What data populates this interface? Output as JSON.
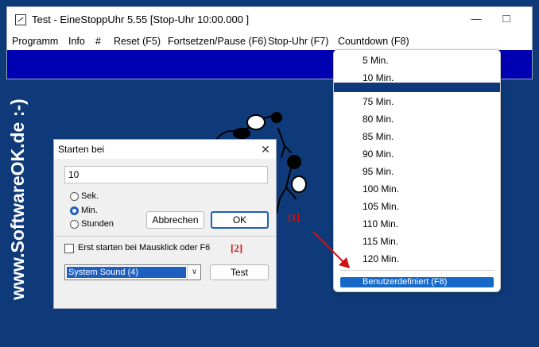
{
  "window": {
    "title": "Test - EineStoppUhr 5.55  [Stop-Uhr  10:00.000 ]",
    "min_glyph": "—",
    "max_glyph": "□",
    "close_glyph": "✕"
  },
  "menu": [
    {
      "label": "Programm"
    },
    {
      "label": "Info"
    },
    {
      "label": "#"
    },
    {
      "label": "Reset  (F5)"
    },
    {
      "label": "Fortsetzen/Pause (F6)"
    },
    {
      "label": "Stop-Uhr  (F7)"
    },
    {
      "label": "Countdown  (F8)"
    }
  ],
  "watermark": "www.SoftwareOK.de  :-)",
  "dropdown": {
    "items": [
      "5 Min.",
      "10 Min.",
      "75 Min.",
      "80 Min.",
      "85 Min.",
      "90 Min.",
      "95 Min.",
      "100 Min.",
      "105 Min.",
      "110 Min.",
      "115 Min.",
      "120 Min."
    ],
    "selected": "Benutzerdefiniert  (F8)"
  },
  "dialog": {
    "title": "Starten bei",
    "close_glyph": "✕",
    "input_value": "10",
    "units": [
      "Sek.",
      "Min.",
      "Stunden"
    ],
    "selected_unit": "Min.",
    "cancel_label": "Abbrechen",
    "ok_label": "OK",
    "checkbox_label": "Erst starten bei Mausklick oder F6",
    "checkbox_checked": false,
    "sound_value": "System Sound (4)",
    "sound_arrow_glyph": "∨",
    "test_label": "Test"
  },
  "annotations": {
    "label_1": "[1]",
    "label_2": "[2]"
  },
  "colors": {
    "background": "#0e3a7a",
    "clock_band": "#0000b3",
    "selection": "#1769c9",
    "annotation": "#d21010"
  }
}
